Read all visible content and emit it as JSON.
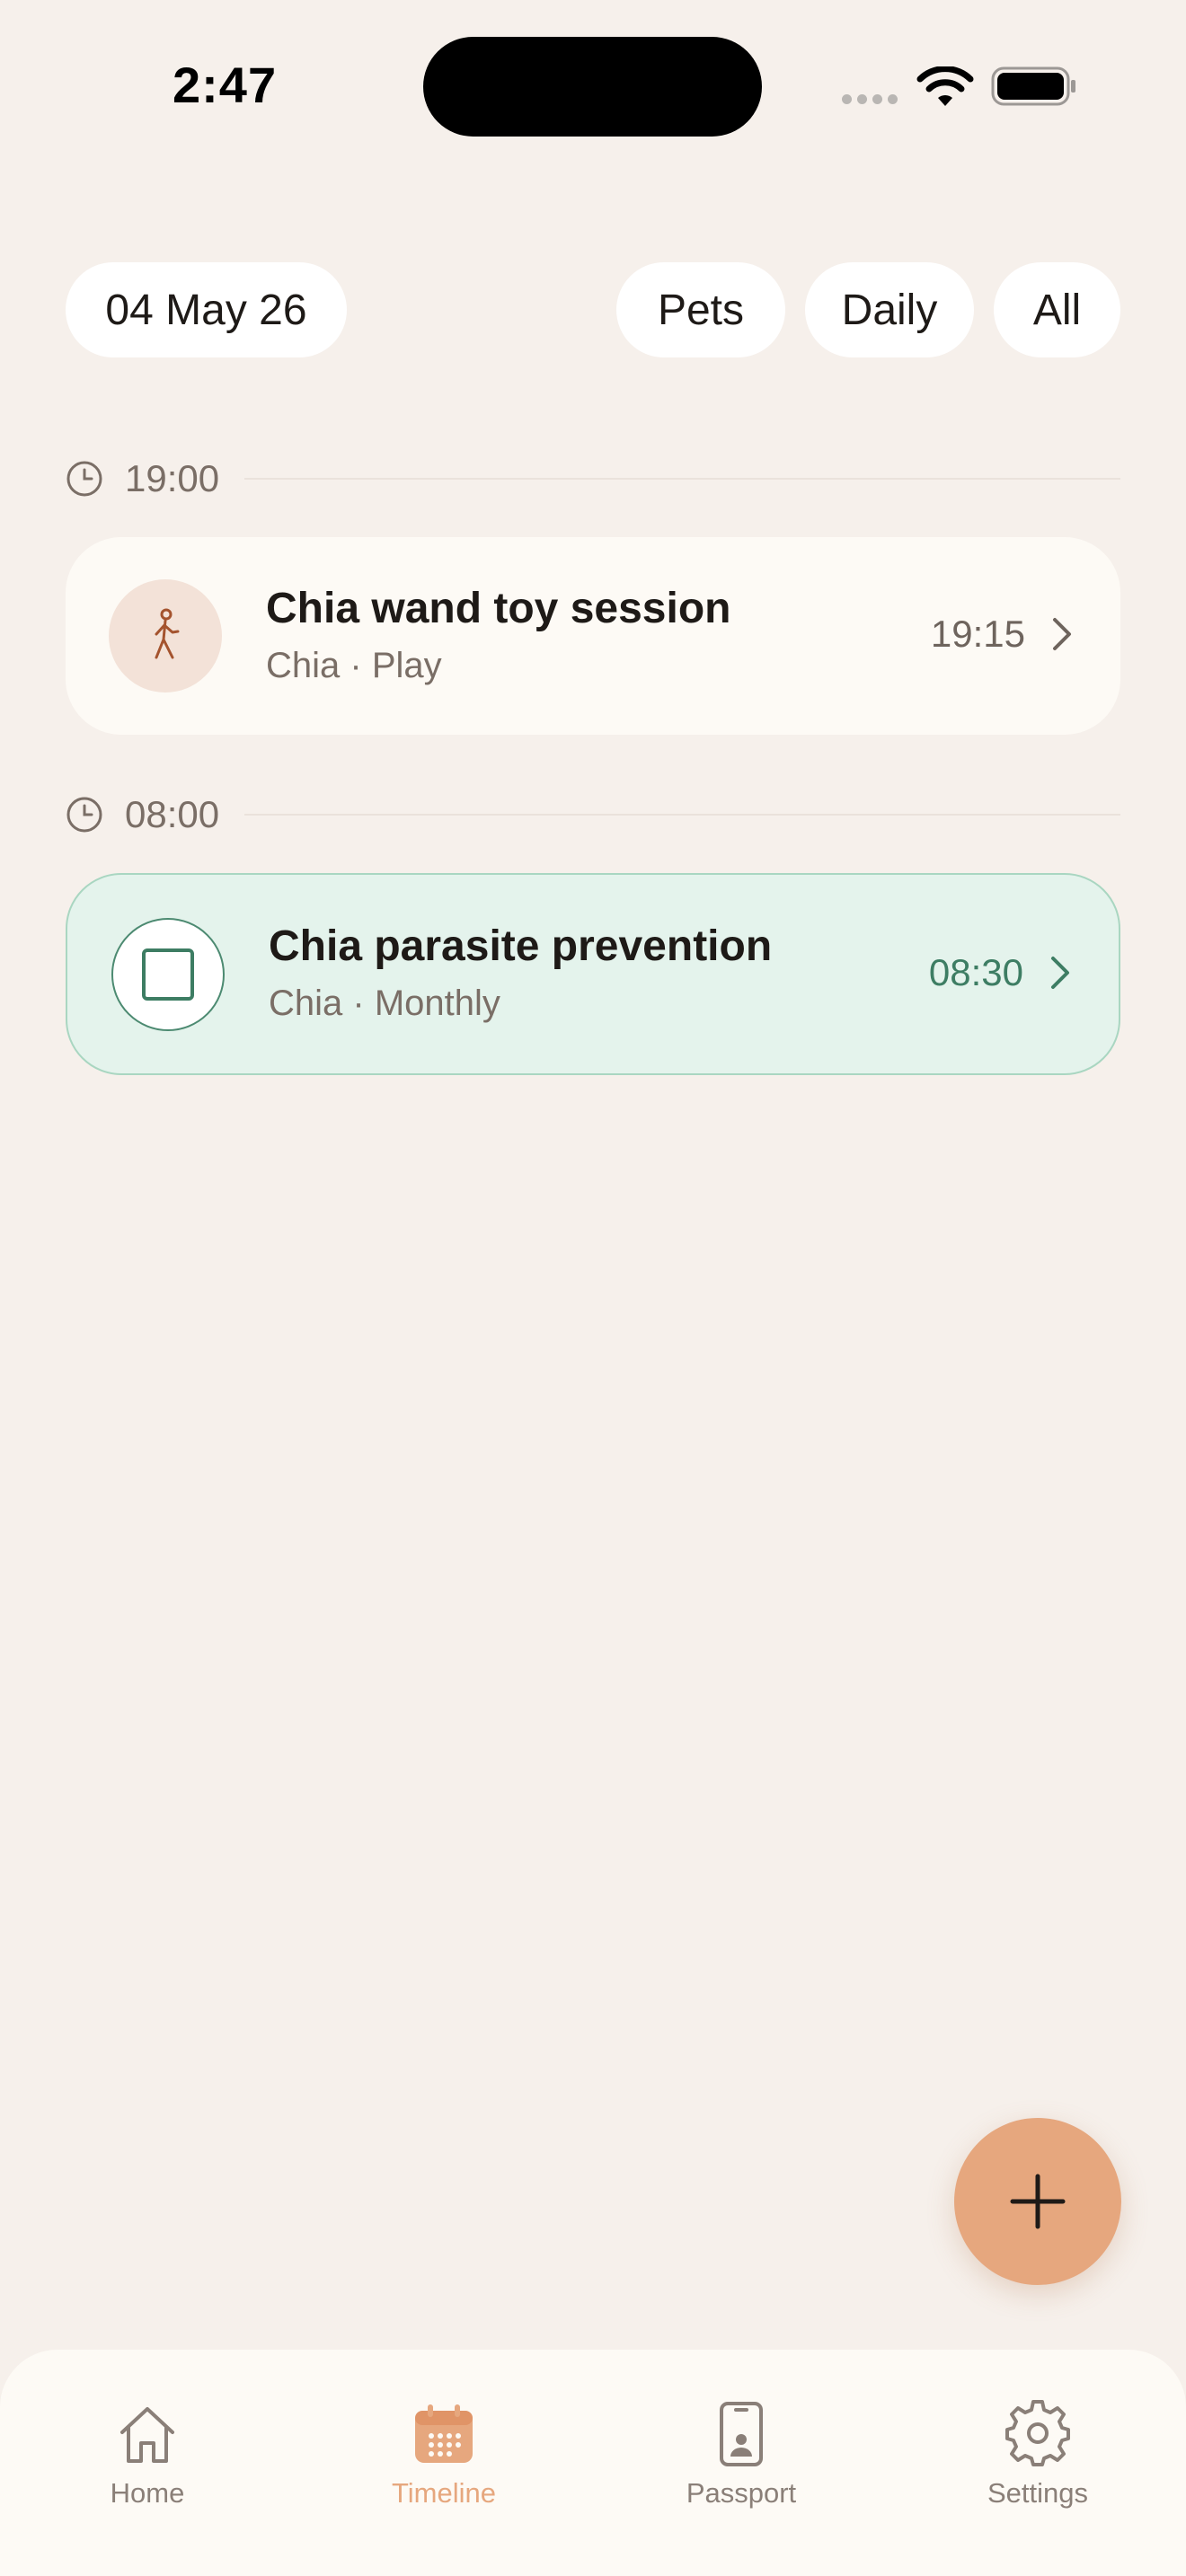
{
  "status_bar": {
    "time": "2:47"
  },
  "filters": {
    "date": "04 May 26",
    "pets": "Pets",
    "frequency": "Daily",
    "category": "All"
  },
  "sections": [
    {
      "time": "19:00",
      "entries": [
        {
          "title": "Chia wand toy session",
          "subtitle": "Chia · Play",
          "time": "19:15",
          "icon": "walking-person-icon"
        }
      ]
    },
    {
      "time": "08:00",
      "entries": [
        {
          "title": "Chia parasite prevention",
          "subtitle": "Chia · Monthly",
          "time": "08:30",
          "icon": "checkbox-icon"
        }
      ]
    }
  ],
  "fab": {
    "icon": "plus-icon"
  },
  "tabs": [
    {
      "label": "Home",
      "icon": "home-icon"
    },
    {
      "label": "Timeline",
      "icon": "calendar-icon",
      "active": true
    },
    {
      "label": "Passport",
      "icon": "passport-icon"
    },
    {
      "label": "Settings",
      "icon": "gear-icon"
    }
  ],
  "colors": {
    "background": "#F6F0EB",
    "accent": "#E6A77E",
    "medication_green": "#3D7D63",
    "card_green_bg": "#E4F3EC"
  }
}
